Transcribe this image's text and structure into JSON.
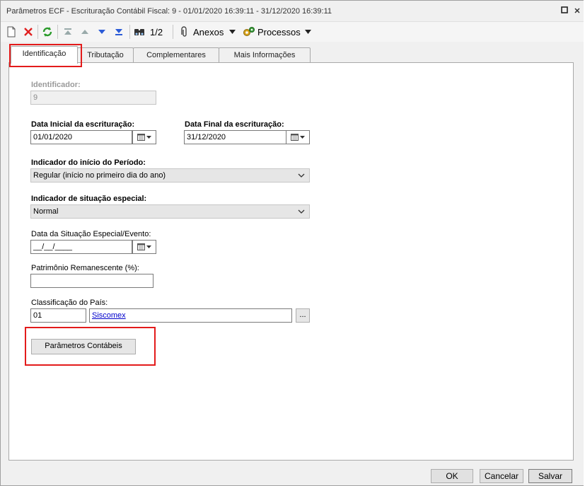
{
  "window": {
    "title": "Parâmetros ECF - Escrituração Contábil Fiscal: 9 - 01/01/2020 16:39:11 - 31/12/2020 16:39:11"
  },
  "toolbar": {
    "record_counter": "1/2",
    "attachments_label": "Anexos",
    "processes_label": "Processos",
    "icons": [
      "new-icon",
      "delete-icon",
      "refresh-icon",
      "first-icon",
      "previous-icon",
      "next-icon",
      "last-icon",
      "search-icon",
      "attachment-icon",
      "processes-icon"
    ]
  },
  "tabs": [
    {
      "label": "Identificação",
      "active": true
    },
    {
      "label": "Tributação",
      "active": false
    },
    {
      "label": "Complementares",
      "active": false
    },
    {
      "label": "Mais Informações",
      "active": false
    }
  ],
  "form": {
    "identificador_label": "Identificador:",
    "identificador_value": "9",
    "data_inicial_label": "Data Inicial da escrituração:",
    "data_inicial_value": "01/01/2020",
    "data_final_label": "Data Final da escrituração:",
    "data_final_value": "31/12/2020",
    "indicador_inicio_label": "Indicador do início do Período:",
    "indicador_inicio_value": "Regular (início no primeiro dia do ano)",
    "indicador_situacao_label": "Indicador de situação especial:",
    "indicador_situacao_value": "Normal",
    "data_situacao_label": "Data da Situação Especial/Evento:",
    "data_situacao_value": "__/__/____",
    "patrimonio_label": "Patrimônio Remanescente (%):",
    "patrimonio_value": "",
    "classificacao_label": "Classificação do País:",
    "classificacao_code": "01",
    "classificacao_link": "Siscomex",
    "lookup_button": "...",
    "parametros_button": "Parâmetros Contábeis"
  },
  "footer": {
    "ok": "OK",
    "cancel": "Cancelar",
    "save": "Salvar"
  },
  "colors": {
    "highlight_red": "#e31b1b",
    "link_blue": "#0000cc"
  }
}
